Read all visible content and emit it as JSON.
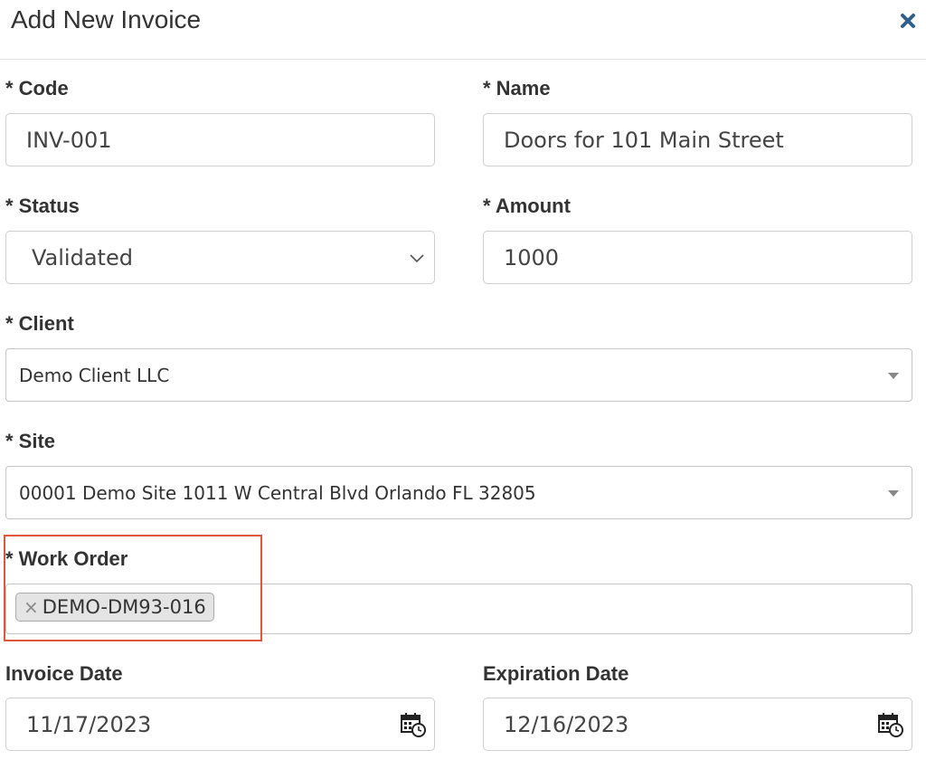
{
  "dialog": {
    "title": "Add New Invoice",
    "close_icon": "close-icon"
  },
  "form": {
    "code": {
      "label": "* Code",
      "value": "INV-001"
    },
    "name": {
      "label": "* Name",
      "value": "Doors for 101 Main Street"
    },
    "status": {
      "label": "* Status",
      "value": "Validated"
    },
    "amount": {
      "label": "* Amount",
      "value": "1000"
    },
    "client": {
      "label": "* Client",
      "value": "Demo Client LLC"
    },
    "site": {
      "label": "* Site",
      "value": "00001 Demo Site 1011 W Central Blvd Orlando FL 32805"
    },
    "work_order": {
      "label": "* Work Order",
      "tags": [
        {
          "remove_symbol": "×",
          "text": "DEMO-DM93-016"
        }
      ]
    },
    "invoice_date": {
      "label": "Invoice Date",
      "value": "11/17/2023",
      "icon": "calendar-icon"
    },
    "expiration_date": {
      "label": "Expiration Date",
      "value": "12/16/2023",
      "icon": "calendar-icon"
    }
  },
  "colors": {
    "close_icon": "#2f5f8a",
    "highlight_box": "#e0553c"
  }
}
